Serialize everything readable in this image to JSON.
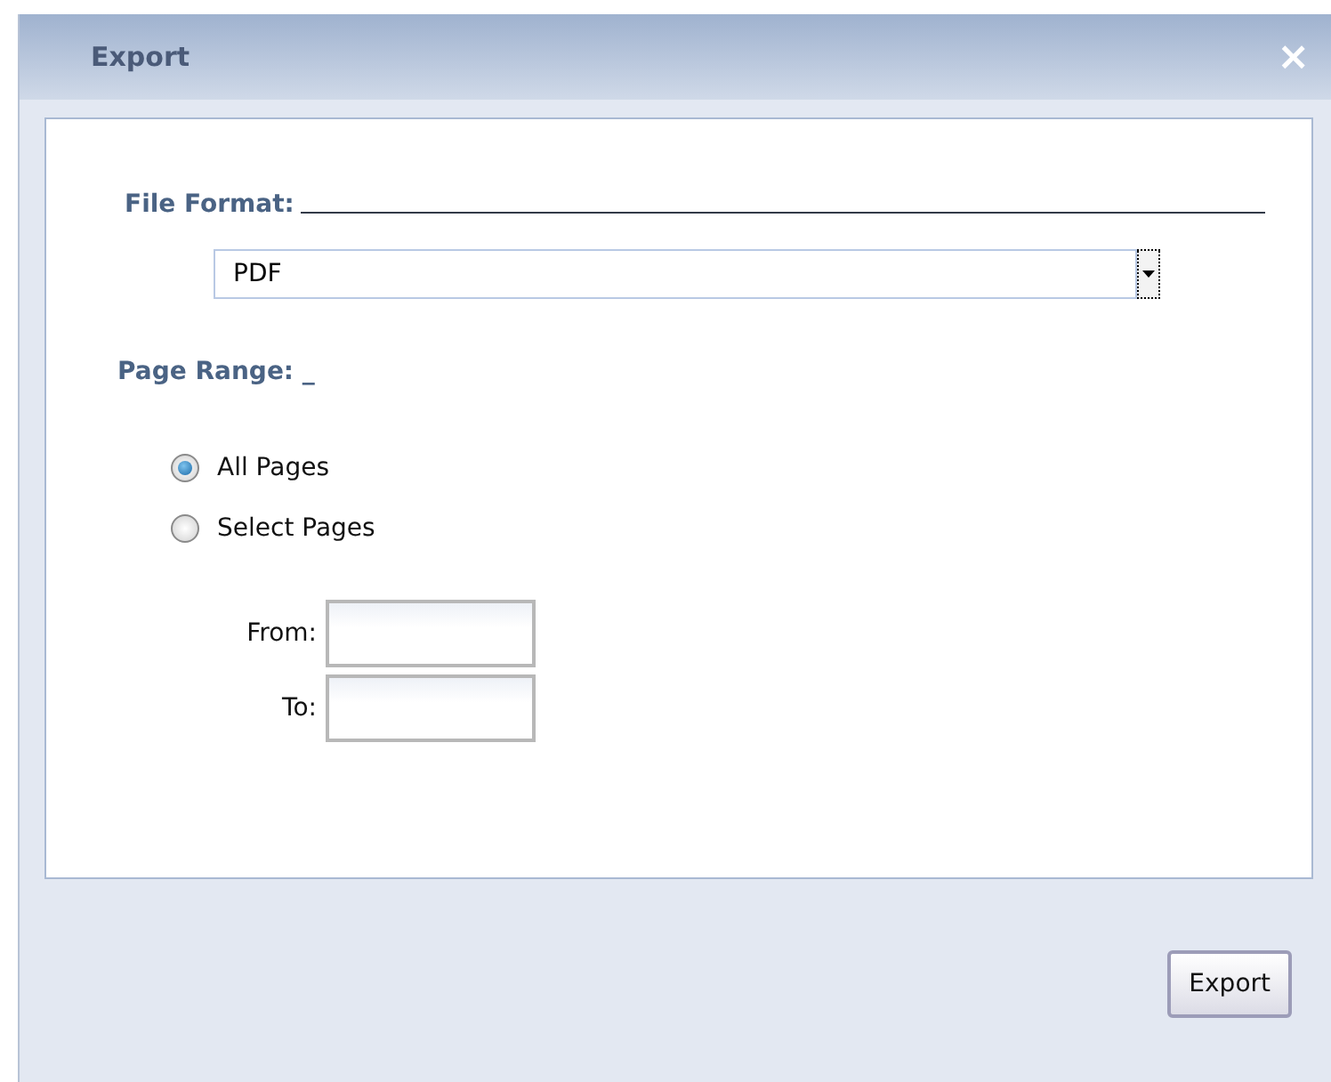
{
  "window": {
    "title": "Export",
    "close": "×"
  },
  "file_format": {
    "label": "File Format:",
    "value": "PDF"
  },
  "page_range": {
    "label": "Page Range: _",
    "options": [
      {
        "label": "All Pages",
        "selected": true
      },
      {
        "label": "Select Pages",
        "selected": false
      }
    ],
    "from": {
      "label": "From:"
    },
    "to": {
      "label": "To:"
    }
  },
  "buttons": [
    "Export"
  ]
}
